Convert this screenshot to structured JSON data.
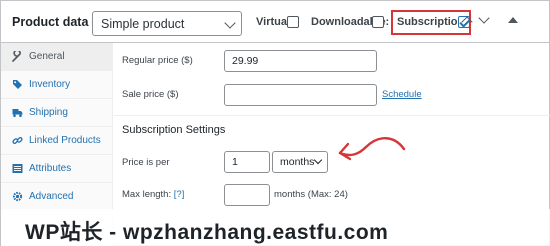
{
  "header": {
    "title": "Product data —",
    "product_type": "Simple product",
    "options": [
      {
        "label": "Virtual:",
        "checked": false
      },
      {
        "label": "Downloadable:",
        "checked": false
      },
      {
        "label": "Subscription:",
        "checked": true
      }
    ],
    "highlight_color": "#d63638"
  },
  "sidebar": {
    "items": [
      {
        "label": "General",
        "icon": "wrench-icon",
        "active": true
      },
      {
        "label": "Inventory",
        "icon": "tag-icon",
        "active": false
      },
      {
        "label": "Shipping",
        "icon": "truck-icon",
        "active": false
      },
      {
        "label": "Linked Products",
        "icon": "link-icon",
        "active": false
      },
      {
        "label": "Attributes",
        "icon": "list-icon",
        "active": false
      },
      {
        "label": "Advanced",
        "icon": "gear-icon",
        "active": false
      }
    ]
  },
  "general": {
    "regular_price_label": "Regular price ($)",
    "regular_price_value": "29.99",
    "sale_price_label": "Sale price ($)",
    "sale_price_value": "",
    "schedule_link": "Schedule",
    "subscription_heading": "Subscription Settings",
    "price_is_per_label": "Price is per",
    "price_is_per_value": "1",
    "period_value": "months",
    "max_length_label": "Max length:",
    "max_length_help": "[?]",
    "max_length_value": "",
    "max_length_suffix": "months (Max: 24)"
  },
  "watermark": {
    "text": "WP站长 - wpzhanzhang.eastfu.com"
  }
}
